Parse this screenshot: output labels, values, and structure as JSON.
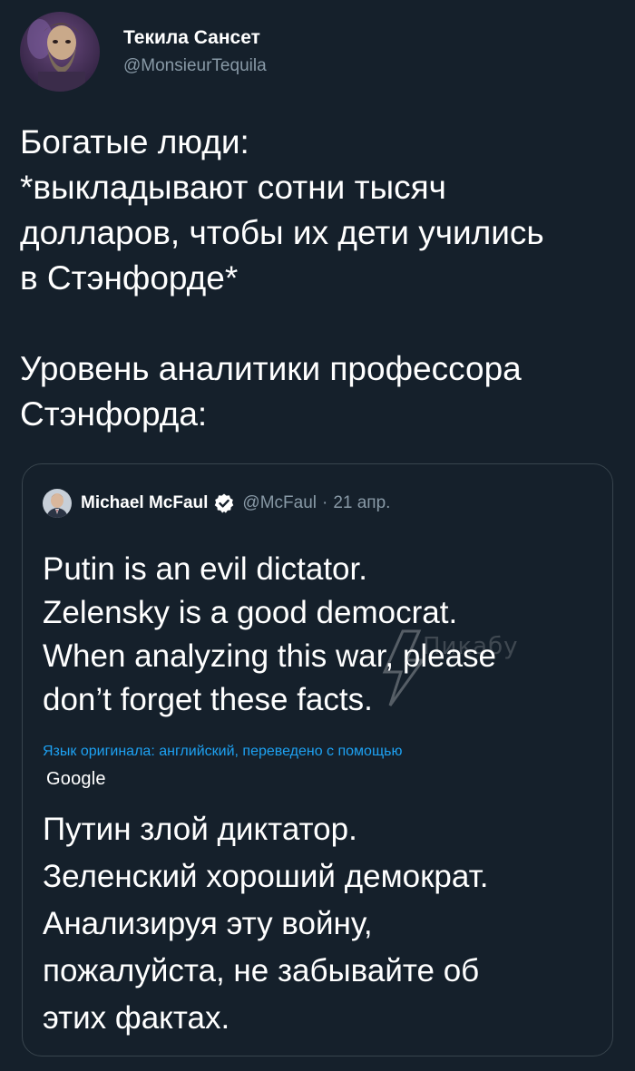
{
  "author": {
    "display_name": "Текила Сансет",
    "handle": "@MonsieurTequila",
    "avatar_icon": "bearded-man-avatar"
  },
  "tweet": {
    "lines": [
      "Богатые люди:",
      "*выкладывают сотни тысяч",
      "долларов, чтобы их дети учились",
      "в Стэнфорде*",
      "Уровень аналитики профессора",
      "Стэнфорда:"
    ]
  },
  "quote": {
    "display_name": "Michael McFaul",
    "verified_icon": "verified-badge-icon",
    "handle": "@McFaul",
    "separator": "·",
    "date": "21 апр.",
    "original_lines": [
      "Putin is an evil dictator.",
      "Zelensky is a good democrat.",
      "When analyzing this war, please",
      "don’t forget these facts."
    ],
    "translation_note": "Язык оригинала: английский, переведено с помощью",
    "translation_service": "Google",
    "translated_lines": [
      "Путин злой диктатор.",
      "Зеленский хороший демократ.",
      "Анализируя эту войну,",
      "пожалуйста, не забывайте об",
      "этих фактах."
    ]
  },
  "colors": {
    "background": "#15202b",
    "text": "#ffffff",
    "secondary_text": "#8899a6",
    "link": "#1da1f2",
    "border": "#38444d"
  },
  "watermark": {
    "text": "Пикабу"
  }
}
